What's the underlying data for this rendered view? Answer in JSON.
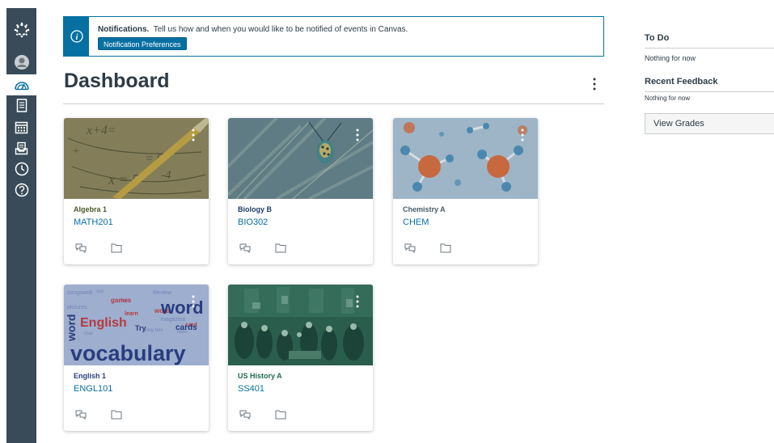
{
  "nav": {
    "items": [
      "logo-icon",
      "account-icon",
      "dashboard-icon",
      "courses-icon",
      "calendar-icon",
      "inbox-icon",
      "history-icon",
      "help-icon"
    ]
  },
  "notification": {
    "title": "Notifications.",
    "message": "Tell us how and when you would like to be notified of events in Canvas.",
    "button_label": "Notification Preferences"
  },
  "dashboard": {
    "title": "Dashboard"
  },
  "courses": [
    {
      "name": "Algebra 1",
      "code": "MATH201",
      "color": "#4b5a27"
    },
    {
      "name": "Biology B",
      "code": "BIO302",
      "color": "#1d3c6a"
    },
    {
      "name": "Chemistry A",
      "code": "CHEM",
      "color": "#4a5b6a"
    },
    {
      "name": "English 1",
      "code": "ENGL101",
      "color": "#2a3e7e"
    },
    {
      "name": "US History A",
      "code": "SS401",
      "color": "#1e6b55"
    }
  ],
  "sidebar": {
    "todo_title": "To Do",
    "todo_empty": "Nothing for now",
    "feedback_title": "Recent Feedback",
    "feedback_empty": "Nothing for now",
    "view_grades": "View Grades"
  },
  "colors": {
    "nav_bg": "#394b58",
    "accent": "#0770a3"
  }
}
